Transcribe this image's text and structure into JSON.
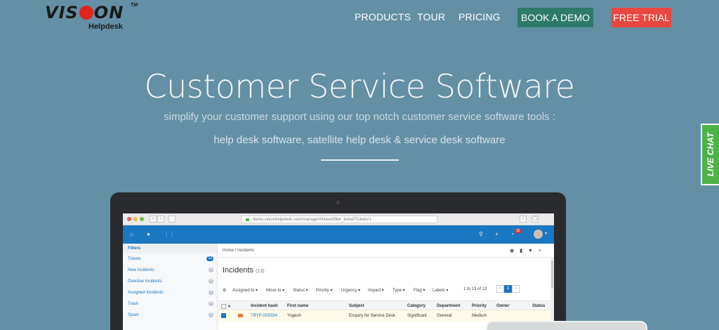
{
  "logo": {
    "word_left": "VIS",
    "word_right": "ON",
    "tm": "TM",
    "sub": "Helpdesk"
  },
  "nav": {
    "products": "PRODUCTS",
    "tour": "TOUR",
    "pricing": "PRICING",
    "book_demo": "BOOK A DEMO",
    "free_trial": "FREE TRIAL"
  },
  "hero": {
    "title": "Customer Service Software",
    "subtitle_1": "simplify your customer support using our top notch customer service software tools :",
    "subtitle_2": "help desk software, satellite help desk & service desk software"
  },
  "live_chat": "LIVE CHAT",
  "app": {
    "url": "demo.visionhelpdesk.com/manage/#/ticket/filter_ticket/Tickets/1",
    "notif_count": "35",
    "sidebar": {
      "heading": "Filters",
      "items": [
        {
          "label": "Tickets",
          "count": "13"
        },
        {
          "label": "New Incidents",
          "count": "0"
        },
        {
          "label": "Overdue Incidents",
          "count": "0"
        },
        {
          "label": "Assigned Incidents",
          "count": "0"
        },
        {
          "label": "Trash",
          "count": "0"
        },
        {
          "label": "Spam",
          "count": "0"
        }
      ]
    },
    "breadcrumb": {
      "home": "Home",
      "sep": "/",
      "current": "Incidents"
    },
    "title": "Incidents",
    "title_count": "(13)",
    "toolbar": [
      "Assigned to ▾",
      "Move to ▾",
      "Status ▾",
      "Priority ▾",
      "Urgency ▾",
      "Impact ▾",
      "Type ▾",
      "Flag ▾",
      "Labels ▾"
    ],
    "pager": {
      "text": "1 to 13 of 13",
      "prev": "‹",
      "page": "1",
      "next": "›"
    },
    "columns": [
      "Incident hash",
      "First name",
      "Subject",
      "Category",
      "Department",
      "Priority",
      "Owner",
      "Status"
    ],
    "row": {
      "hash": "TBYP-009334",
      "first_name": "Yogesh",
      "subject": "Enquiry for Service Desk",
      "category": "Significant",
      "department": "General",
      "priority": "Medium"
    }
  }
}
